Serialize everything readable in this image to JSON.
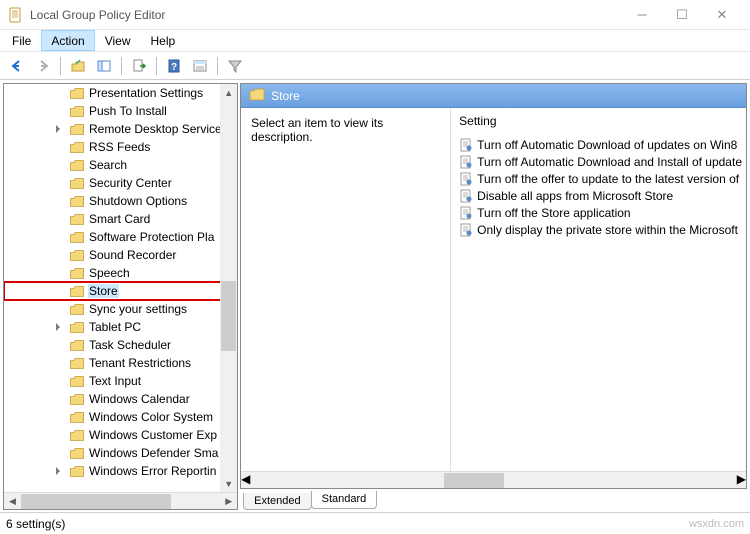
{
  "window": {
    "title": "Local Group Policy Editor"
  },
  "menubar": {
    "items": [
      "File",
      "Action",
      "View",
      "Help"
    ],
    "selected_index": 1
  },
  "tree": {
    "items": [
      {
        "label": "Presentation Settings",
        "expand": false
      },
      {
        "label": "Push To Install",
        "expand": false
      },
      {
        "label": "Remote Desktop Service",
        "expand": true
      },
      {
        "label": "RSS Feeds",
        "expand": false
      },
      {
        "label": "Search",
        "expand": false
      },
      {
        "label": "Security Center",
        "expand": false
      },
      {
        "label": "Shutdown Options",
        "expand": false
      },
      {
        "label": "Smart Card",
        "expand": false
      },
      {
        "label": "Software Protection Pla",
        "expand": false
      },
      {
        "label": "Sound Recorder",
        "expand": false
      },
      {
        "label": "Speech",
        "expand": false
      },
      {
        "label": "Store",
        "expand": false,
        "highlight": true,
        "selected": true
      },
      {
        "label": "Sync your settings",
        "expand": false
      },
      {
        "label": "Tablet PC",
        "expand": true
      },
      {
        "label": "Task Scheduler",
        "expand": false
      },
      {
        "label": "Tenant Restrictions",
        "expand": false
      },
      {
        "label": "Text Input",
        "expand": false
      },
      {
        "label": "Windows Calendar",
        "expand": false
      },
      {
        "label": "Windows Color System",
        "expand": false
      },
      {
        "label": "Windows Customer Exp",
        "expand": false
      },
      {
        "label": "Windows Defender Sma",
        "expand": false
      },
      {
        "label": "Windows Error Reportin",
        "expand": true
      }
    ]
  },
  "detail": {
    "header_title": "Store",
    "desc_text": "Select an item to view its description.",
    "setting_header": "Setting",
    "settings": [
      "Turn off Automatic Download of updates on Win8",
      "Turn off Automatic Download and Install of update",
      "Turn off the offer to update to the latest version of",
      "Disable all apps from Microsoft Store",
      "Turn off the Store application",
      "Only display the private store within the Microsoft"
    ]
  },
  "tabs": {
    "items": [
      "Extended",
      "Standard"
    ],
    "active_index": 1
  },
  "statusbar": {
    "text": "6 setting(s)",
    "watermark": "wsxdn.com"
  }
}
